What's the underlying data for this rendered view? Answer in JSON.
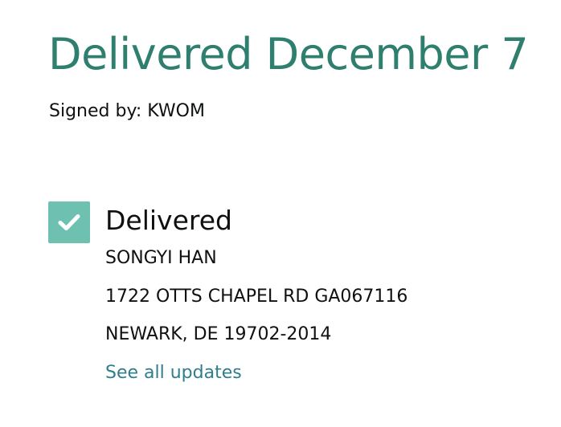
{
  "colors": {
    "headline": "#2f7f6f",
    "check_bg": "#6ec0b0",
    "link": "#2f7e8c",
    "text": "#0f1111"
  },
  "delivery": {
    "headline": "Delivered December 7",
    "signed_by": "Signed by: KWOM"
  },
  "status": {
    "icon": "check-icon",
    "title": "Delivered",
    "recipient": "SONGYI HAN",
    "address_line1": "1722 OTTS CHAPEL RD GA067116",
    "address_line2": "NEWARK, DE 19702-2014",
    "link_label": "See all updates"
  }
}
